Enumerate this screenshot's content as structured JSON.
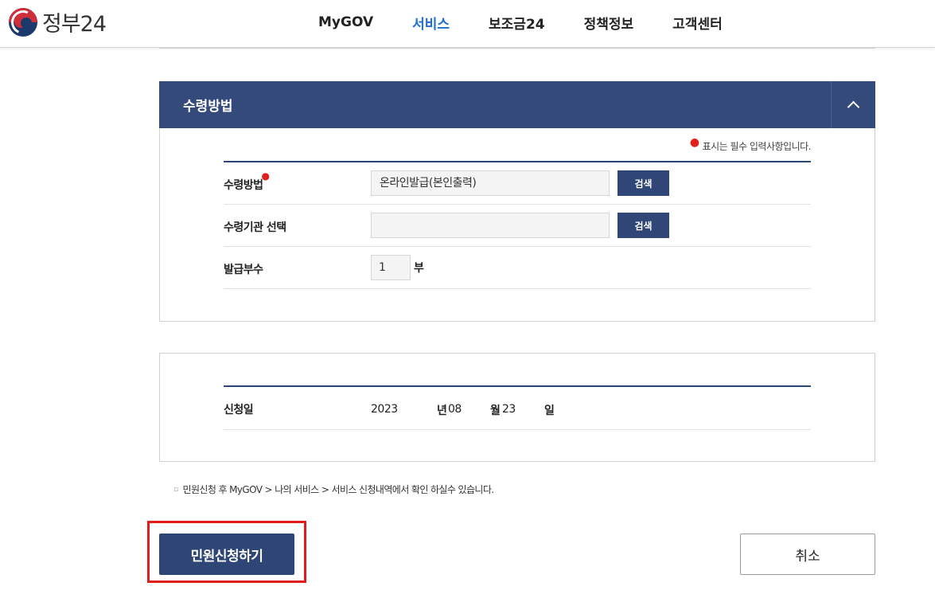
{
  "header": {
    "logo_text": "정부24",
    "nav": [
      {
        "label": "MyGOV",
        "active": false
      },
      {
        "label": "서비스",
        "active": true
      },
      {
        "label": "보조금24",
        "active": false
      },
      {
        "label": "정책정보",
        "active": false
      },
      {
        "label": "고객센터",
        "active": false
      }
    ]
  },
  "receipt_panel": {
    "title": "수령방법",
    "required_note": "표시는 필수 입력사항입니다.",
    "rows": {
      "method": {
        "label": "수령방법",
        "value": "온라인발급(본인출력)",
        "button": "검색",
        "required": true
      },
      "institution": {
        "label": "수령기관 선택",
        "value": "",
        "button": "검색"
      },
      "copies": {
        "label": "발급부수",
        "value": "1",
        "unit": "부"
      }
    }
  },
  "date_panel": {
    "label": "신청일",
    "year": "2023",
    "year_unit": "년",
    "month": "08",
    "month_unit": "월",
    "day": "23",
    "day_unit": "일"
  },
  "notice": "민원신청 후 MyGOV > 나의 서비스 > 서비스 신청내역에서 확인 하실수 있습니다.",
  "actions": {
    "apply_label": "민원신청하기",
    "cancel_label": "취소"
  },
  "colors": {
    "primary_navy": "#2e4575",
    "nav_active": "#1d6fd1",
    "required_red": "#e0201b",
    "highlight_red": "#e21b1b"
  }
}
